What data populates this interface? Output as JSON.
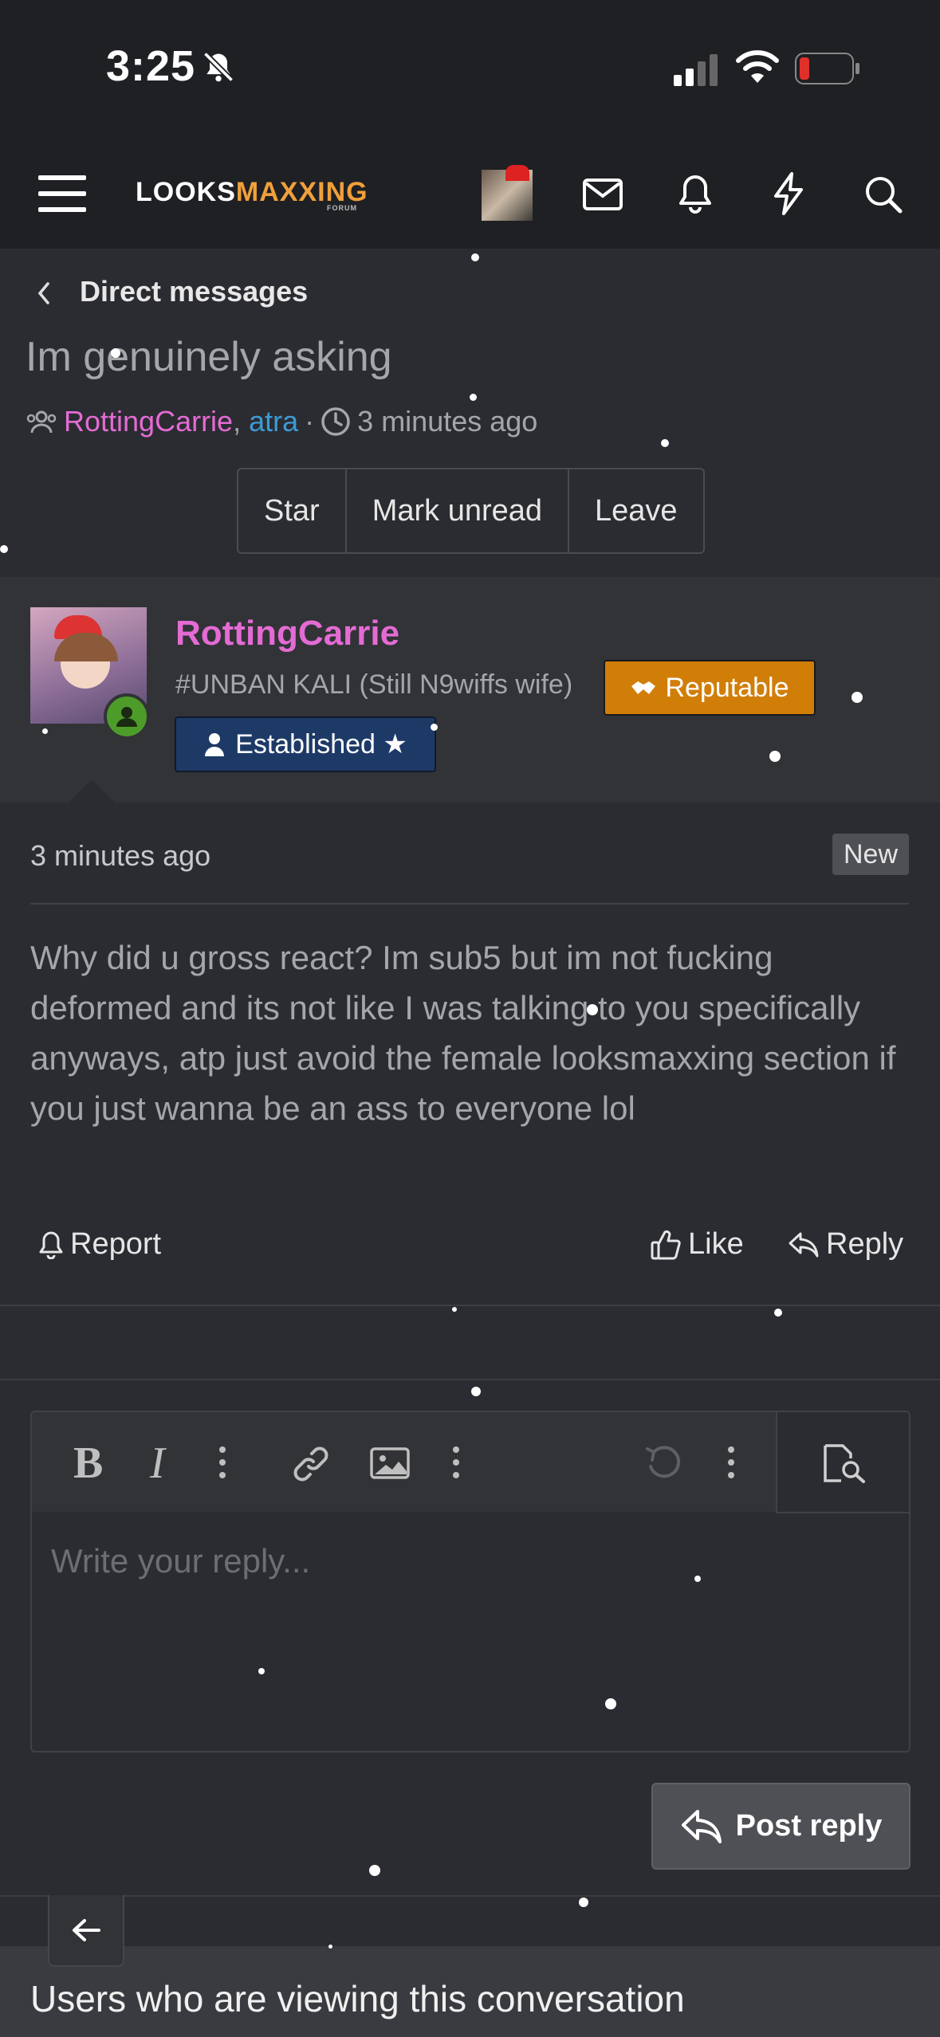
{
  "status_bar": {
    "time": "3:25"
  },
  "header": {
    "logo_white_1": "LOOKS",
    "logo_orange": "MAXXIN",
    "logo_ring": "G",
    "logo_sub": "FORUM",
    "icons": [
      "menu-icon",
      "avatar",
      "mail-icon",
      "bell-icon",
      "bolt-icon",
      "search-icon"
    ]
  },
  "breadcrumb": {
    "label": "Direct messages"
  },
  "conversation": {
    "title": "Im genuinely asking",
    "participant_1": "RottingCarrie",
    "separator_comma": ",",
    "participant_2": "atra",
    "separator_dot": "·",
    "started": "3 minutes ago",
    "buttons": {
      "star": "Star",
      "mark_unread": "Mark unread",
      "leave": "Leave"
    }
  },
  "message": {
    "username": "RottingCarrie",
    "user_title": "#UNBAN KALI (Still N9wiffs wife)",
    "badge_reputable": "Reputable",
    "badge_established": "Established ★",
    "time": "3 minutes ago",
    "new_label": "New",
    "text": "Why did u gross react? Im sub5 but im not fucking deformed and its not like I was talking to you specifically anyways, atp just avoid the female looksmaxxing section if you just wanna be an ass to everyone lol",
    "actions": {
      "report": "Report",
      "like": "Like",
      "reply": "Reply"
    }
  },
  "editor": {
    "placeholder": "Write your reply...",
    "submit_label": "Post reply"
  },
  "footer": {
    "viewing_title": "Users who are viewing this conversation"
  },
  "colors": {
    "background": "#2b2c31",
    "header": "#1f2024",
    "username_pink": "#e46bd4",
    "link_blue": "#3d9bd6",
    "reputable_orange": "#d17e08",
    "established_navy": "#1d3a67"
  }
}
